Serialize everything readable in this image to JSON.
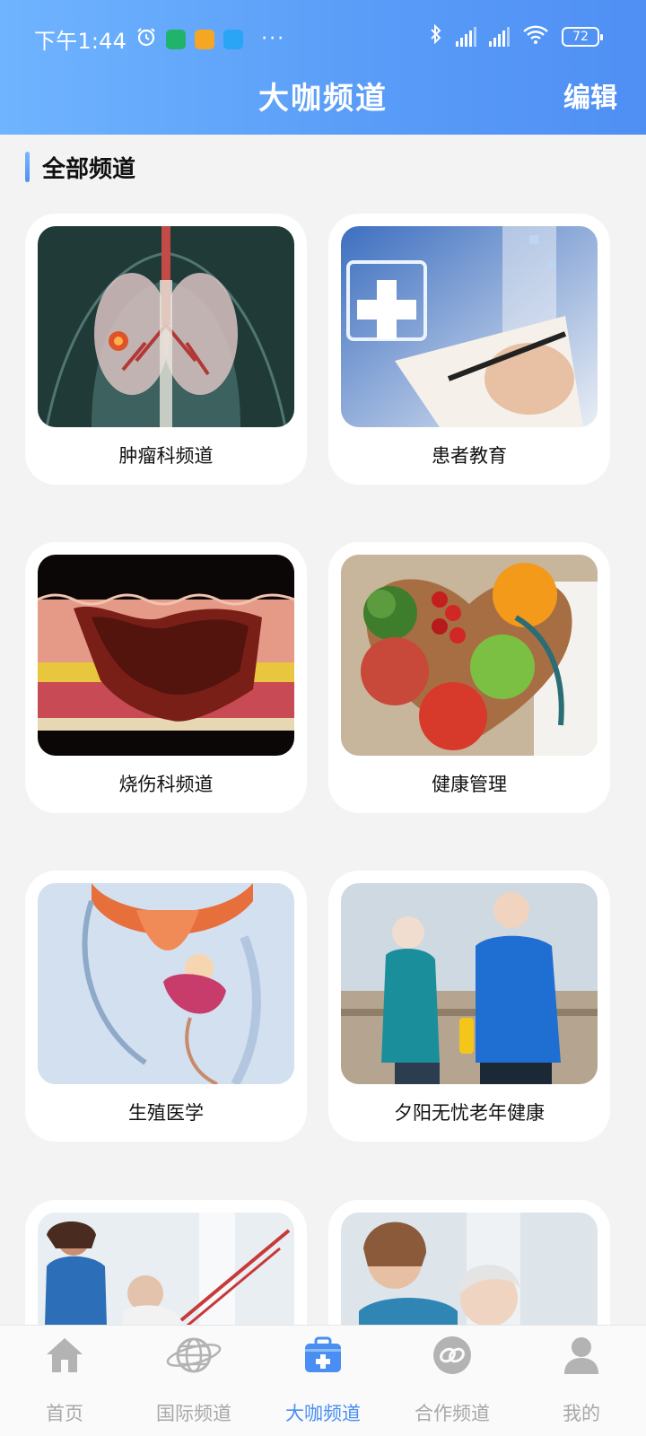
{
  "status_bar": {
    "time": "下午1:44",
    "dots": "···",
    "battery": "72"
  },
  "header": {
    "title": "大咖频道",
    "edit_label": "编辑"
  },
  "section": {
    "title": "全部频道"
  },
  "channels": [
    {
      "label": "肿瘤科频道",
      "icon": "lungs-illustration"
    },
    {
      "label": "患者教育",
      "icon": "medical-writing-illustration"
    },
    {
      "label": "烧伤科频道",
      "icon": "skin-burn-illustration"
    },
    {
      "label": "健康管理",
      "icon": "healthy-food-illustration"
    },
    {
      "label": "生殖医学",
      "icon": "reproductive-anatomy-illustration"
    },
    {
      "label": "夕阳无忧老年健康",
      "icon": "elderly-jogging-photo"
    },
    {
      "label": "",
      "icon": "rehab-exercise-photo"
    },
    {
      "label": "",
      "icon": "nurse-elderly-photo"
    }
  ],
  "bottom_nav": {
    "items": [
      {
        "label": "首页",
        "icon": "home-icon"
      },
      {
        "label": "国际频道",
        "icon": "globe-icon"
      },
      {
        "label": "大咖频道",
        "icon": "medkit-icon"
      },
      {
        "label": "合作频道",
        "icon": "link-icon"
      },
      {
        "label": "我的",
        "icon": "user-icon"
      }
    ],
    "active_index": 2
  },
  "colors": {
    "accent": "#4a8ef3",
    "header_from": "#6fb4ff",
    "header_to": "#4f8ff4",
    "inactive": "#a8a8a8"
  }
}
